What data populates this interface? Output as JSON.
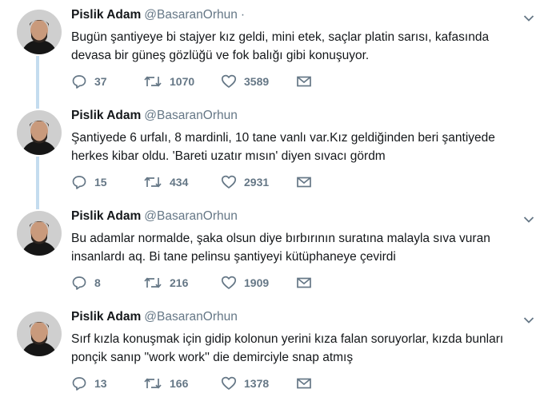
{
  "tweets": [
    {
      "name": "Pislik Adam",
      "handle": "@BasaranOrhun",
      "separator": "·",
      "text": "Bugün şantiyeye bi stajyer kız geldi, mini etek, saçlar platin sarısı, kafasında devasa bir güneş gözlüğü ve fok balığı gibi konuşuyor.",
      "replies": "37",
      "retweets": "1070",
      "likes": "3589"
    },
    {
      "name": "Pislik Adam",
      "handle": "@BasaranOrhun",
      "separator": "",
      "text": "Şantiyede 6 urfalı, 8 mardinli, 10 tane vanlı var.Kız geldiğinden beri şantiyede herkes kibar oldu. 'Bareti uzatır mısın' diyen sıvacı gördm",
      "replies": "15",
      "retweets": "434",
      "likes": "2931"
    },
    {
      "name": "Pislik Adam",
      "handle": "@BasaranOrhun",
      "separator": "",
      "text": "Bu adamlar normalde, şaka olsun diye bırbırının suratına malayla sıva vuran insanlardı aq. Bi tane pelinsu şantiyeyi kütüphaneye çevirdi",
      "replies": "8",
      "retweets": "216",
      "likes": "1909"
    },
    {
      "name": "Pislik Adam",
      "handle": "@BasaranOrhun",
      "separator": "",
      "text": "Sırf kızla konuşmak için gidip kolonun yerini kıza falan soruyorlar, kızda bunları ponçik sanıp ''work work'' die demirciyle snap atmış",
      "replies": "13",
      "retweets": "166",
      "likes": "1378"
    }
  ],
  "icons": {
    "reply": "reply-icon",
    "retweet": "retweet-icon",
    "like": "heart-icon",
    "dm": "envelope-icon",
    "caret": "chevron-down-icon"
  },
  "colors": {
    "text": "#14171a",
    "secondary": "#657786",
    "thread_rail": "#c4dcef"
  }
}
